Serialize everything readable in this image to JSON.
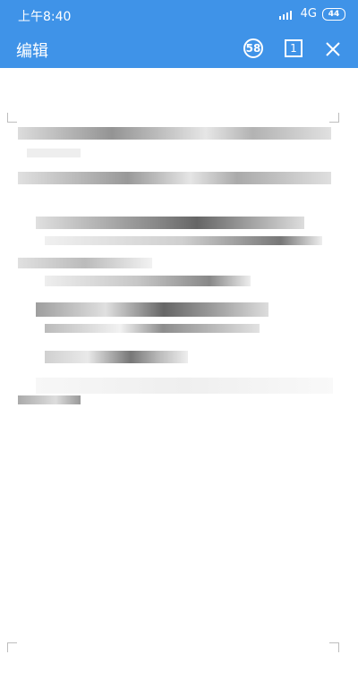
{
  "status_bar": {
    "time": "上午8:40",
    "network": "4G",
    "battery": "44"
  },
  "toolbar": {
    "title": "编辑",
    "comment_count": "58",
    "page_number": "1"
  },
  "document": {
    "content_note": "",
    "icons": [
      "comment-count-icon",
      "page-icon",
      "close-icon"
    ]
  }
}
